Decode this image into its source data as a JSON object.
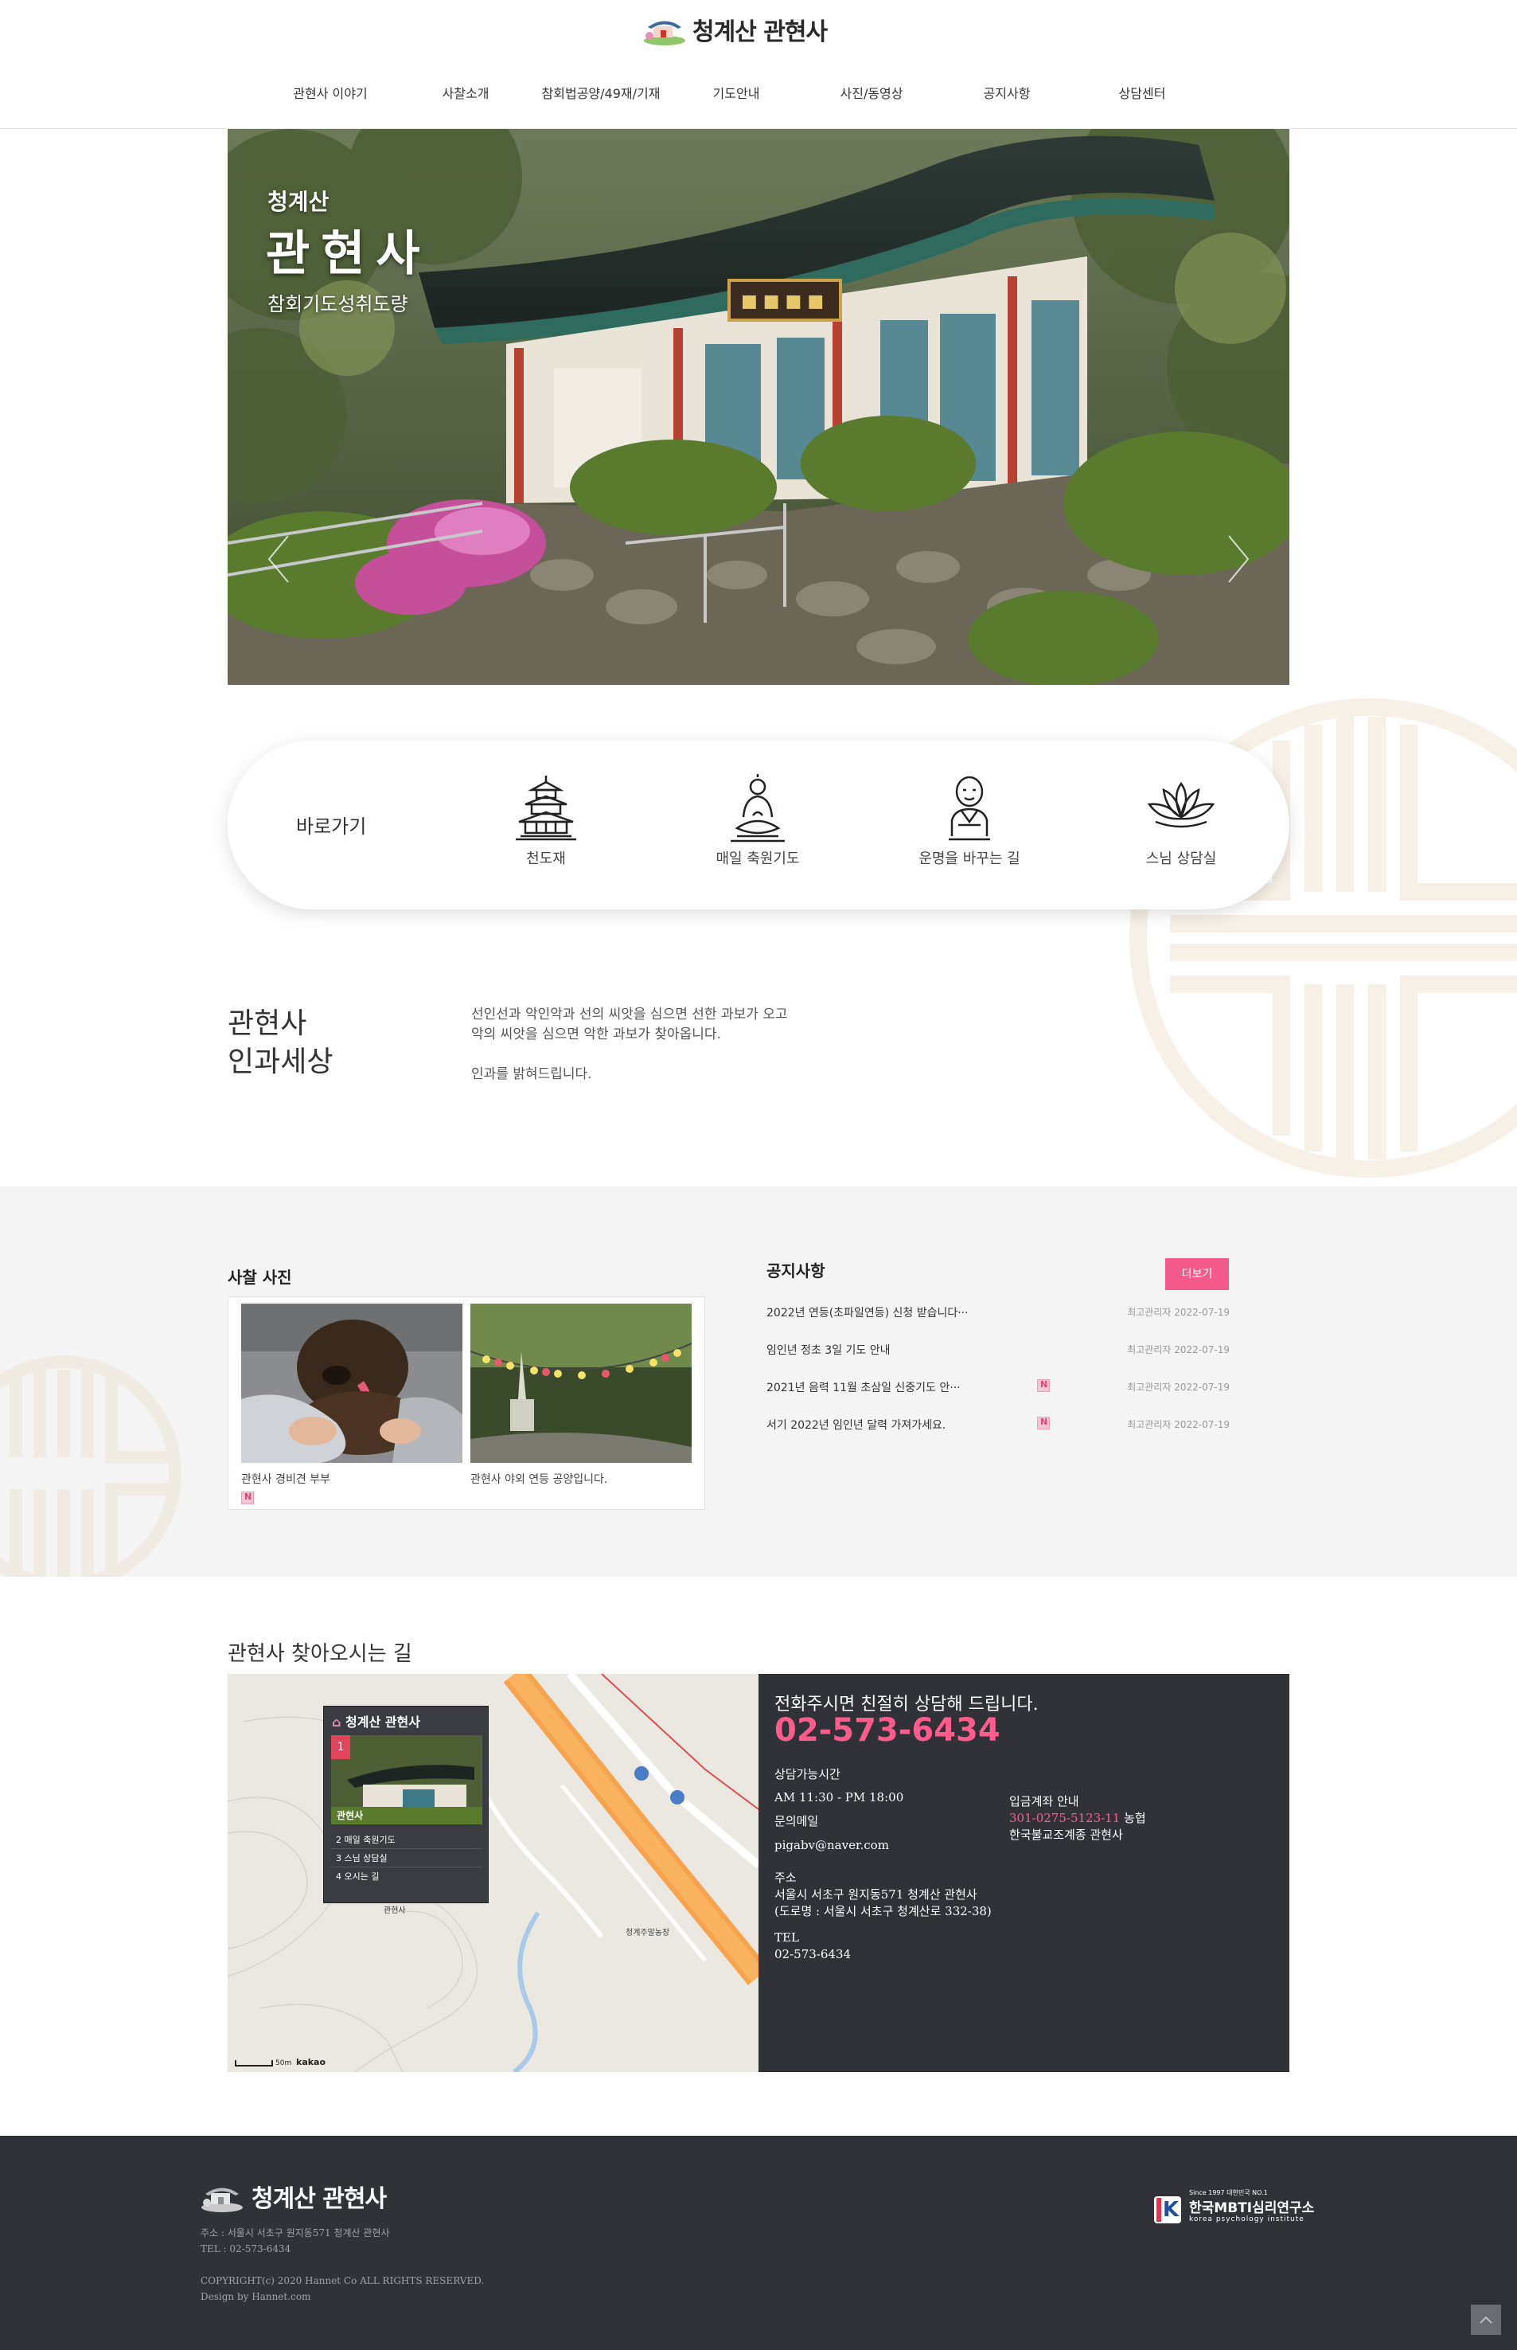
{
  "header": {
    "logo_text": "청계산 관현사",
    "nav": [
      "관현사 이야기",
      "사찰소개",
      "참회법공양/49재/기재",
      "기도안내",
      "사진/동영상",
      "공지사항",
      "상담센터"
    ]
  },
  "hero": {
    "subtitle": "청계산",
    "title": "관현사",
    "description": "참회기도성취도량",
    "prev_icon": "chevron-left",
    "next_icon": "chevron-right"
  },
  "quick_links": {
    "label": "바로가기",
    "items": [
      {
        "label": "천도재",
        "icon": "pagoda-icon"
      },
      {
        "label": "매일 축원기도",
        "icon": "buddha-icon"
      },
      {
        "label": "운명을 바꾸는 길",
        "icon": "monk-icon"
      },
      {
        "label": "스님 상담실",
        "icon": "lotus-icon"
      }
    ]
  },
  "intro": {
    "title_line1": "관현사",
    "title_line2": "인과세상",
    "text_line1": "선인선과 악인악과 선의 씨앗을 심으면 선한 과보가 오고",
    "text_line2": "악의 씨앗을 심으면 악한 과보가 찾아옵니다.",
    "text_line3": "인과를 밝혀드립니다."
  },
  "photos": {
    "title": "사찰 사진",
    "items": [
      {
        "caption": "관현사 경비견 부부"
      },
      {
        "caption": "관현사 야외 연등 공양입니다."
      }
    ]
  },
  "notice": {
    "title": "공지사항",
    "more_label": "더보기",
    "items": [
      {
        "title": "2022년 연등(초파일연등) 신청 받습니다···",
        "author": "최고관리자",
        "date": "2022-07-19",
        "new": false
      },
      {
        "title": "임인년 정초 3일 기도 안내",
        "author": "최고관리자",
        "date": "2022-07-19",
        "new": false
      },
      {
        "title": "2021년 음력 11월 초삼일 신중기도 안···",
        "author": "최고관리자",
        "date": "2022-07-19",
        "new": true
      },
      {
        "title": "서기 2022년 임인년 달력 가져가세요.",
        "author": "최고관리자",
        "date": "2022-07-19",
        "new": true
      }
    ]
  },
  "directions": {
    "title": "관현사 찾아오시는 길",
    "map": {
      "popup_title": "청계산 관현사",
      "popup_badge": "1",
      "popup_caption": "관현사",
      "popup_items": [
        "2 매일 축원기도",
        "3 스님 상담실",
        "4 오시는 길"
      ],
      "place_label": "청계주말농장",
      "pin_label": "관현사",
      "scale": "50m",
      "brand": "kakao"
    },
    "info": {
      "lead": "전화주시면 친절히 상담해 드립니다.",
      "phone": "02-573-6434",
      "hours_label": "상담가능시간",
      "hours": "AM 11:30 - PM 18:00",
      "email_label": "문의메일",
      "email": "pigabv@naver.com",
      "address_label": "주소",
      "address": "서울시 서초구 원지동571 청계산 관현사",
      "road_address": "(도로명 : 서울시 서초구 청계산로 332-38)",
      "tel_label": "TEL",
      "tel": "02-573-6434",
      "bank_label": "입금계좌 안내",
      "account": "301-0275-5123-11",
      "bank": "농협",
      "holder": "한국불교조계종 관현사"
    }
  },
  "footer": {
    "logo_text": "청계산 관현사",
    "address": "주소 : 서울시 서초구 원지동571 청계산 관현사",
    "tel": "TEL : 02-573-6434",
    "copyright": "COPYRIGHT(c) 2020 Hannet Co ALL RIGHTS RESERVED.",
    "design": "Design by Hannet.com",
    "partner_since": "Since 1997 대한민국 NO.1",
    "partner_name": "한국MBTI심리연구소",
    "partner_en": "korea psychology institute",
    "partner_mark": "K"
  },
  "colors": {
    "accent": "#f45b8d",
    "phone": "#ff5c8d",
    "dark_panel": "#303238",
    "gray_bg": "#f4f4f4",
    "pattern": "#f6f0e6"
  }
}
